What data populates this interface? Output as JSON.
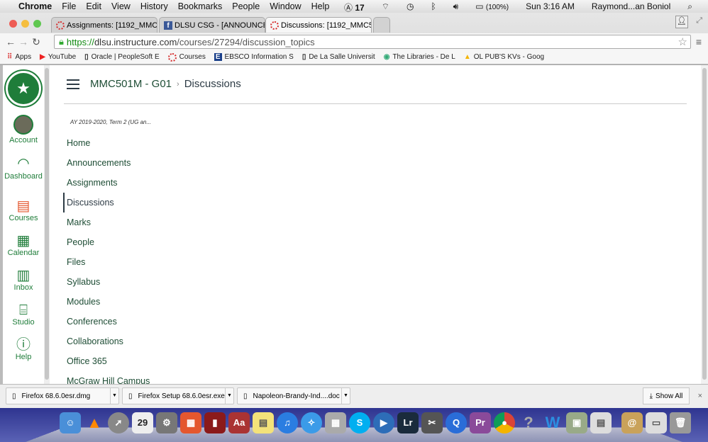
{
  "menubar": {
    "app": "Chrome",
    "items": [
      "File",
      "Edit",
      "View",
      "History",
      "Bookmarks",
      "People",
      "Window",
      "Help"
    ],
    "status": {
      "adobe": "17",
      "battery": "(100%)",
      "clock": "Sun 3:16 AM",
      "user": "Raymond...an Boniol"
    }
  },
  "tabs": [
    {
      "title": "Assignments: [1192_MMC",
      "icon": "canvas-icon"
    },
    {
      "title": "DLSU CSG - [ANNOUNCEM",
      "icon": "facebook-icon"
    },
    {
      "title": "Discussions: [1192_MMC5",
      "icon": "canvas-icon",
      "active": true
    }
  ],
  "address": {
    "scheme": "https://",
    "host": "dlsu.instructure.com",
    "path": "/courses/27294/discussion_topics"
  },
  "bookmarks": [
    "Apps",
    "YouTube",
    "Oracle | PeopleSoft E",
    "Courses",
    "EBSCO Information S",
    "De La Salle Universit",
    "The Libraries - De L",
    "OL PUB'S KVs - Goog"
  ],
  "global_nav": [
    {
      "label": "Account",
      "icon": "avatar"
    },
    {
      "label": "Dashboard",
      "icon": "dashboard-icon"
    },
    {
      "label": "Courses",
      "icon": "courses-icon"
    },
    {
      "label": "Calendar",
      "icon": "calendar-icon"
    },
    {
      "label": "Inbox",
      "icon": "inbox-icon"
    },
    {
      "label": "Studio",
      "icon": "studio-icon"
    },
    {
      "label": "Help",
      "icon": "help-icon"
    }
  ],
  "breadcrumb": {
    "course": "MMC501M - G01",
    "page": "Discussions"
  },
  "term": "AY 2019-2020, Term 2 (UG an...",
  "course_nav": [
    "Home",
    "Announcements",
    "Assignments",
    "Discussions",
    "Marks",
    "People",
    "Files",
    "Syllabus",
    "Modules",
    "Conferences",
    "Collaborations",
    "Office 365",
    "McGraw Hill Campus"
  ],
  "active_course_nav": "Discussions",
  "downloads": [
    "Firefox 68.6.0esr.dmg",
    "Firefox Setup 68.6.0esr.exe",
    "Napoleon-Brandy-Ind....doc"
  ],
  "show_all": "Show All",
  "colors": {
    "canvas_green": "#1f7d3a",
    "nav_text": "#1e4d35"
  }
}
